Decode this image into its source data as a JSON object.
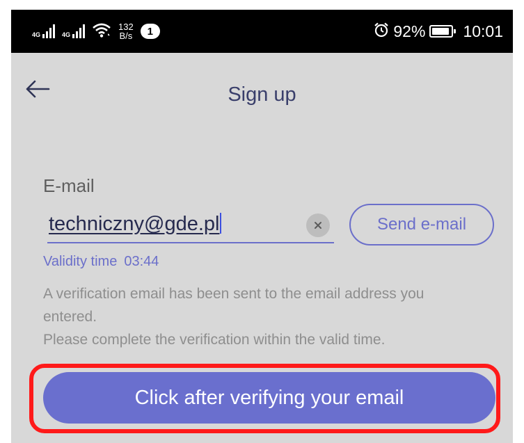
{
  "status_bar": {
    "signal_1_label": "4G",
    "signal_2_label": "4G",
    "net_speed_value": "132",
    "net_speed_unit": "B/s",
    "notification_count": "1",
    "battery_percent": "92%",
    "time": "10:01",
    "icons": [
      "signal-icon",
      "wifi-icon",
      "alarm-icon",
      "battery-icon"
    ]
  },
  "header": {
    "back_icon": "arrow-left-icon",
    "title": "Sign up"
  },
  "form": {
    "email_label": "E-mail",
    "email_value": "techniczny@gde.pl",
    "clear_icon": "close-icon",
    "send_button_label": "Send e-mail",
    "validity_label": "Validity time",
    "validity_time": "03:44",
    "info_line_1": "A verification email has been sent to the email address you",
    "info_line_2": "entered.",
    "info_line_3": "Please complete the verification within the valid time."
  },
  "primary_button": {
    "label": "Click after verifying your email"
  },
  "colors": {
    "accent": "#6a6fce",
    "background": "#d8d8d8",
    "highlight": "#ff1a1a"
  }
}
